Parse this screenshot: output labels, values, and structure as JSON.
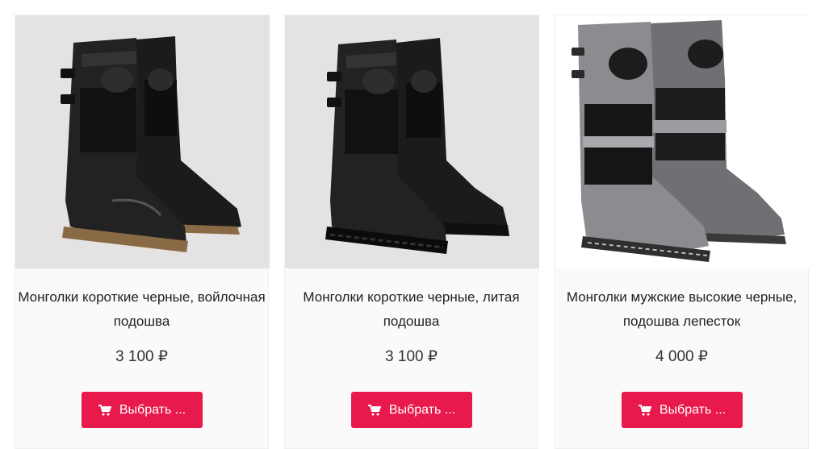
{
  "products": [
    {
      "title": "Монголки короткие черные, войлочная подошва",
      "price": "3 100 ₽",
      "button_label": "Выбрать ..."
    },
    {
      "title": "Монголки короткие черные, литая подошва",
      "price": "3 100 ₽",
      "button_label": "Выбрать ..."
    },
    {
      "title": "Монголки мужские высокие черные, подошва лепесток",
      "price": "4 000 ₽",
      "button_label": "Выбрать ..."
    }
  ],
  "colors": {
    "button_bg": "#e8194d",
    "photo_bg": "#e4e2e3"
  },
  "icons": {
    "button_icon": "cart-icon"
  }
}
